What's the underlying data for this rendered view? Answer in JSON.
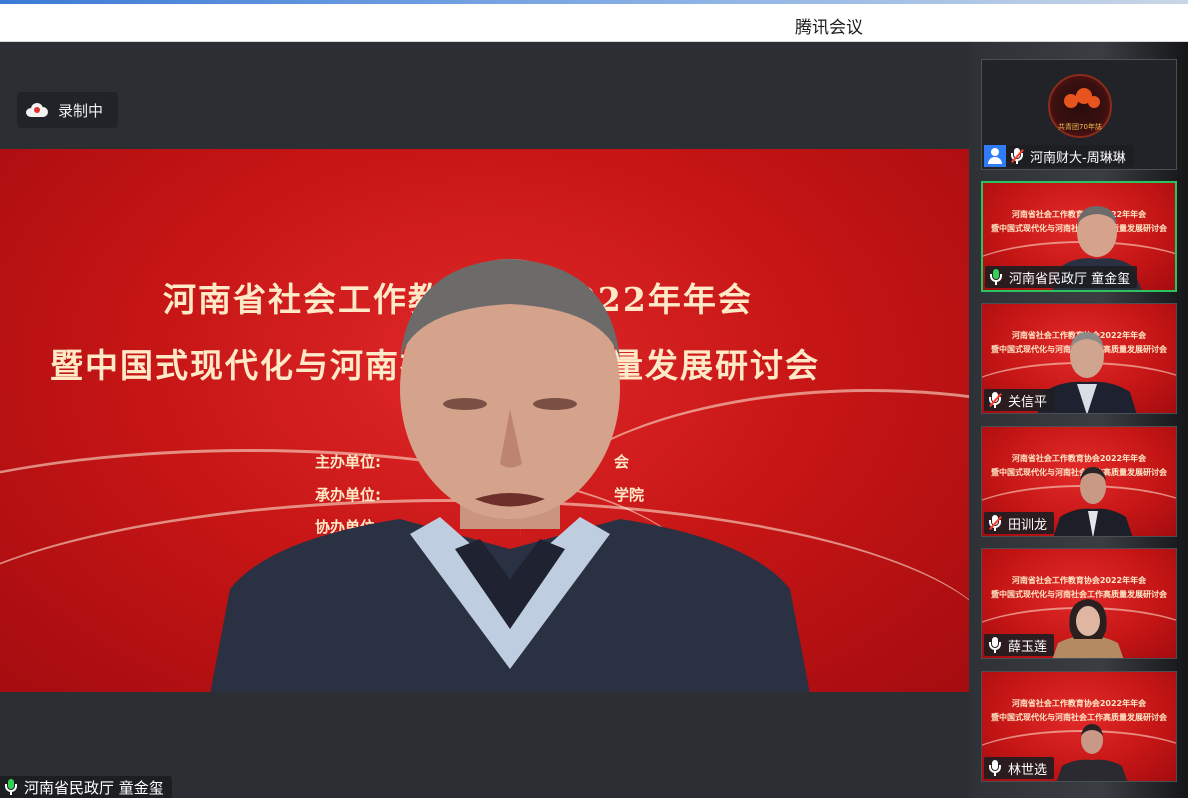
{
  "window": {
    "title": "腾讯会议"
  },
  "recording": {
    "label": "录制中",
    "icon": "cloud-record-icon"
  },
  "main_video": {
    "slide_title_line1": "河南省社会工作教育协会2022年年会",
    "slide_title_line2": "暨中国式现代化与河南社会工作高质量发展研讨会",
    "slide_host_label": "主办单位:",
    "slide_organizer_label": "承办单位:",
    "slide_co_organizer_label": "协办单位:",
    "slide_host_tail": "会",
    "slide_organizer_tail": "学院",
    "speaker_name": "河南省民政厅 童金玺",
    "speaker_mic": "mic-active"
  },
  "participants": [
    {
      "name": "河南财大-周琳琳",
      "mic": "muted",
      "video": "off",
      "logo_text": "共青团70年誌"
    },
    {
      "name": "河南省民政厅 童金玺",
      "mic": "active",
      "video": "on",
      "active": true
    },
    {
      "name": "关信平",
      "mic": "muted",
      "video": "on"
    },
    {
      "name": "田训龙",
      "mic": "muted",
      "video": "on"
    },
    {
      "name": "薛玉莲",
      "mic": "unmuted",
      "video": "on"
    },
    {
      "name": "林世选",
      "mic": "unmuted",
      "video": "on"
    }
  ],
  "tile_slide": {
    "line1": "河南省社会工作教育协会2022年年会",
    "line2": "暨中国式现代化与河南社会工作高质量发展研讨会"
  },
  "colors": {
    "slide_red": "#c61515",
    "active_border": "#2cc35f",
    "accent_blue": "#2f7cf6"
  }
}
